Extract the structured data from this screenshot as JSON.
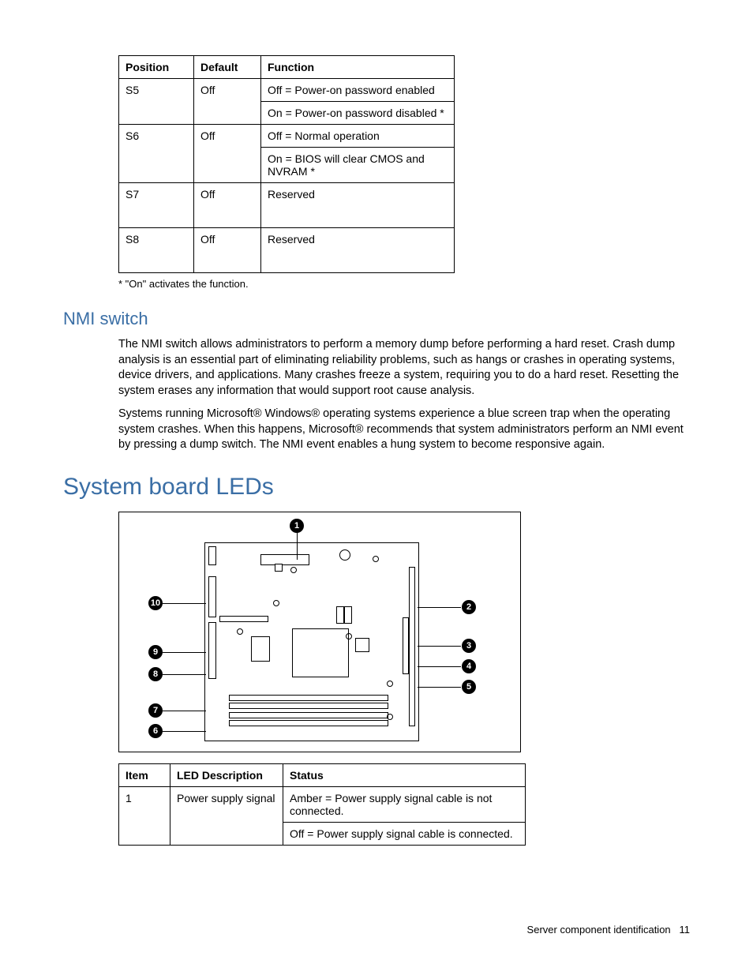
{
  "table1": {
    "headers": [
      "Position",
      "Default",
      "Function"
    ],
    "rows": [
      {
        "position": "S5",
        "default": "Off",
        "func1": "Off = Power-on password enabled",
        "func2": "On = Power-on password disabled *"
      },
      {
        "position": "S6",
        "default": "Off",
        "func1": "Off = Normal operation",
        "func2": "On = BIOS will clear CMOS and NVRAM *"
      },
      {
        "position": "S7",
        "default": "Off",
        "func1": "Reserved",
        "func2": ""
      },
      {
        "position": "S8",
        "default": "Off",
        "func1": "Reserved",
        "func2": ""
      }
    ]
  },
  "footnote": "* \"On\" activates the function.",
  "section_nmi": "NMI switch",
  "nmi_p1": "The NMI switch allows administrators to perform a memory dump before performing a hard reset. Crash dump analysis is an essential part of eliminating reliability problems, such as hangs or crashes in operating systems, device drivers, and applications. Many crashes freeze a system, requiring you to do a hard reset. Resetting the system erases any information that would support root cause analysis.",
  "nmi_p2": "Systems running Microsoft® Windows® operating systems experience a blue screen trap when the operating system crashes. When this happens, Microsoft® recommends that system administrators perform an NMI event by pressing a dump switch. The NMI event enables a hung system to become responsive again.",
  "section_leds": "System board LEDs",
  "callouts": [
    "1",
    "2",
    "3",
    "4",
    "5",
    "6",
    "7",
    "8",
    "9",
    "10"
  ],
  "table2": {
    "headers": [
      "Item",
      "LED Description",
      "Status"
    ],
    "rows": [
      {
        "item": "1",
        "desc": "Power supply signal",
        "s1": "Amber = Power supply signal cable is not connected.",
        "s2": "Off = Power supply signal cable is connected."
      }
    ]
  },
  "footer_text": "Server component identification",
  "footer_page": "11"
}
